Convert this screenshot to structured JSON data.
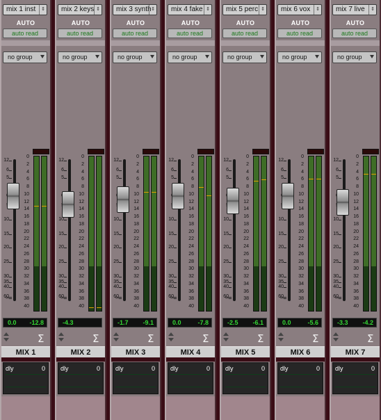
{
  "strips": [
    {
      "name": "mix 1 inst",
      "automation": "AUTO",
      "auto_mode": "auto read",
      "group": "no group",
      "volume": "0.0",
      "peak": "-12.8",
      "output": "MIX 1",
      "dly_label": "dly",
      "dly_value": "0",
      "fader_db": 0.0,
      "meter_db": [
        -12.8,
        -12.8
      ]
    },
    {
      "name": "mix 2 keys",
      "automation": "AUTO",
      "auto_mode": "auto read",
      "group": "no group",
      "volume": "-4.3",
      "peak": "",
      "output": "MIX 2",
      "dly_label": "dly",
      "dly_value": "0",
      "fader_db": -4.3,
      "meter_db": [
        -40,
        -40
      ]
    },
    {
      "name": "mix 3 synth",
      "automation": "AUTO",
      "auto_mode": "auto read",
      "group": "no group",
      "volume": "-1.7",
      "peak": "-9.1",
      "output": "MIX 3",
      "dly_label": "dly",
      "dly_value": "0",
      "fader_db": -1.7,
      "meter_db": [
        -9.1,
        -9.1
      ]
    },
    {
      "name": "mix 4 fake",
      "automation": "AUTO",
      "auto_mode": "auto read",
      "group": "no group",
      "volume": "0.0",
      "peak": "-7.8",
      "output": "MIX 4",
      "dly_label": "dly",
      "dly_value": "0",
      "fader_db": 0.0,
      "meter_db": [
        -7.8,
        -10
      ]
    },
    {
      "name": "mix 5 perc",
      "automation": "AUTO",
      "auto_mode": "auto read",
      "group": "no group",
      "volume": "-2.5",
      "peak": "-6.1",
      "output": "MIX 5",
      "dly_label": "dly",
      "dly_value": "0",
      "fader_db": -2.5,
      "meter_db": [
        -6.1,
        -5.8
      ]
    },
    {
      "name": "mix 6 vox",
      "automation": "AUTO",
      "auto_mode": "auto read",
      "group": "no group",
      "volume": "0.0",
      "peak": "-5.6",
      "output": "MIX 6",
      "dly_label": "dly",
      "dly_value": "0",
      "fader_db": 0.0,
      "meter_db": [
        -5.6,
        -5.6
      ]
    },
    {
      "name": "mix 7 live",
      "automation": "AUTO",
      "auto_mode": "auto read",
      "group": "no group",
      "volume": "-3.3",
      "peak": "-4.2",
      "output": "MIX 7",
      "dly_label": "dly",
      "dly_value": "0",
      "fader_db": -3.3,
      "meter_db": [
        -4.2,
        -4.2
      ]
    }
  ],
  "fader_scale": [
    "12",
    "6",
    "5",
    "0",
    "5",
    "10",
    "15",
    "20",
    "25",
    "30",
    "35",
    "40",
    "60",
    "∞"
  ],
  "meter_scale": [
    "0",
    "2",
    "4",
    "6",
    "8",
    "10",
    "12",
    "14",
    "16",
    "18",
    "20",
    "22",
    "24",
    "26",
    "28",
    "30",
    "32",
    "34",
    "36",
    "38",
    "40"
  ],
  "colors": {
    "readout": "#34d634",
    "automation": "#1d7a1d",
    "meter": "#3e6d26",
    "peak_line": "#e0a000"
  },
  "icons": {
    "sigma": "Σ",
    "up_down": "up-down-arrows-icon"
  }
}
